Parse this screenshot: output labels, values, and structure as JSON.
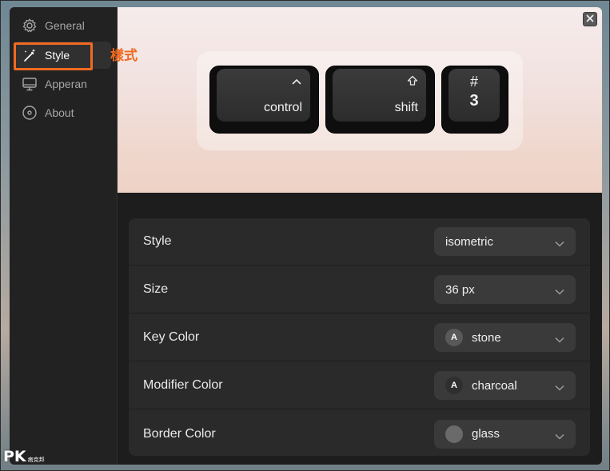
{
  "sidebar": {
    "items": [
      {
        "label": "General",
        "icon": "gear-icon"
      },
      {
        "label": "Style",
        "icon": "magic-wand-icon",
        "active": true
      },
      {
        "label": "Apperan",
        "icon": "monitor-icon"
      },
      {
        "label": "About",
        "icon": "info-circle-icon"
      }
    ]
  },
  "annotation": {
    "style_label": "樣式",
    "color": "#f06a23"
  },
  "preview": {
    "keys": [
      {
        "glyph": "^",
        "label": "control"
      },
      {
        "glyph": "⇧",
        "label": "shift"
      },
      {
        "glyph": "#",
        "label": "3"
      }
    ]
  },
  "settings": {
    "rows": [
      {
        "label": "Style",
        "value": "isometric"
      },
      {
        "label": "Size",
        "value": "36 px"
      },
      {
        "label": "Key Color",
        "value": "stone",
        "swatch_letter": "A",
        "swatch_color": "#595959"
      },
      {
        "label": "Modifier Color",
        "value": "charcoal",
        "swatch_letter": "A",
        "swatch_color": "#2f2f2f"
      },
      {
        "label": "Border Color",
        "value": "glass",
        "swatch_color": "#6a6a6a"
      }
    ]
  },
  "watermark": {
    "main": "PK",
    "sub": "痞克邦"
  }
}
